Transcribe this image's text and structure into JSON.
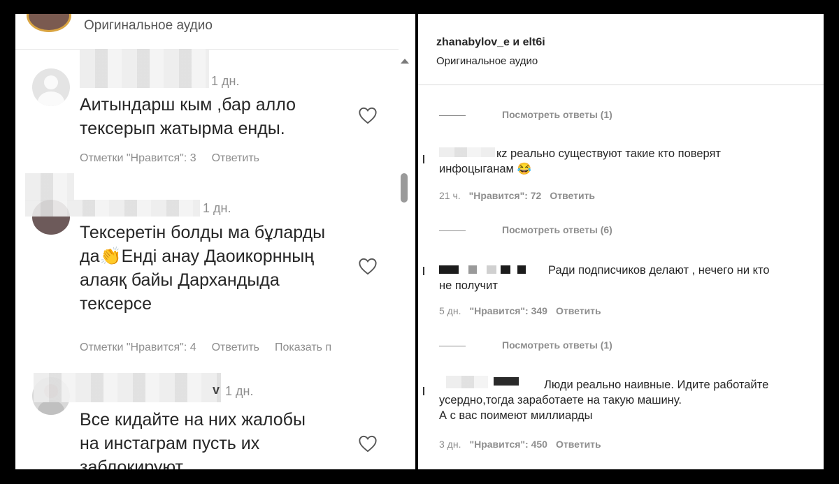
{
  "left": {
    "audio_label": "Оригинальное аудио",
    "comments": [
      {
        "time": "1 дн.",
        "text_lines": [
          "Аитындарш кым ,бар алло",
          "тексерып жатырма енды."
        ],
        "likes": "Отметки \"Нравится\": 3",
        "reply": "Ответить"
      },
      {
        "time": "1 дн.",
        "text_lines": [
          "Тексеретін болды ма бұларды",
          "да👏Енді анау Даоикорнның",
          "алаяқ байы Дархандыда",
          "тексерсе"
        ],
        "likes": "Отметки \"Нравится\": 4",
        "reply": "Ответить",
        "show": "Показать п"
      },
      {
        "name_end": "v",
        "time": "1 дн.",
        "text_lines": [
          "Все кидайте на них жалобы",
          "на инстаграм пусть их",
          "заблокируют"
        ]
      }
    ]
  },
  "right": {
    "title": "zhanabylov_e и elt6i",
    "audio_label": "Оригинальное аудио",
    "comments": [
      {
        "replies": "Посмотреть ответы (1)",
        "text_lines": [
          "кz реально существуют такие кто поверят",
          "инфоцыганам 😂"
        ],
        "time": "21 ч.",
        "likes": "\"Нравится\": 72",
        "reply": "Ответить"
      },
      {
        "replies": "Посмотреть ответы (6)",
        "text_lines": [
          "Ради подписчиков делают , нечего ни кто",
          "не получит"
        ],
        "time": "5 дн.",
        "likes": "\"Нравится\": 349",
        "reply": "Ответить"
      },
      {
        "replies": "Посмотреть ответы (1)",
        "text_lines": [
          "Люди реально наивные. Идите работайте",
          "усердно,тогда заработаете на такую машину.",
          "А с вас поимеют миллиарды"
        ],
        "time": "3 дн.",
        "likes": "\"Нравится\": 450",
        "reply": "Ответить"
      }
    ]
  }
}
